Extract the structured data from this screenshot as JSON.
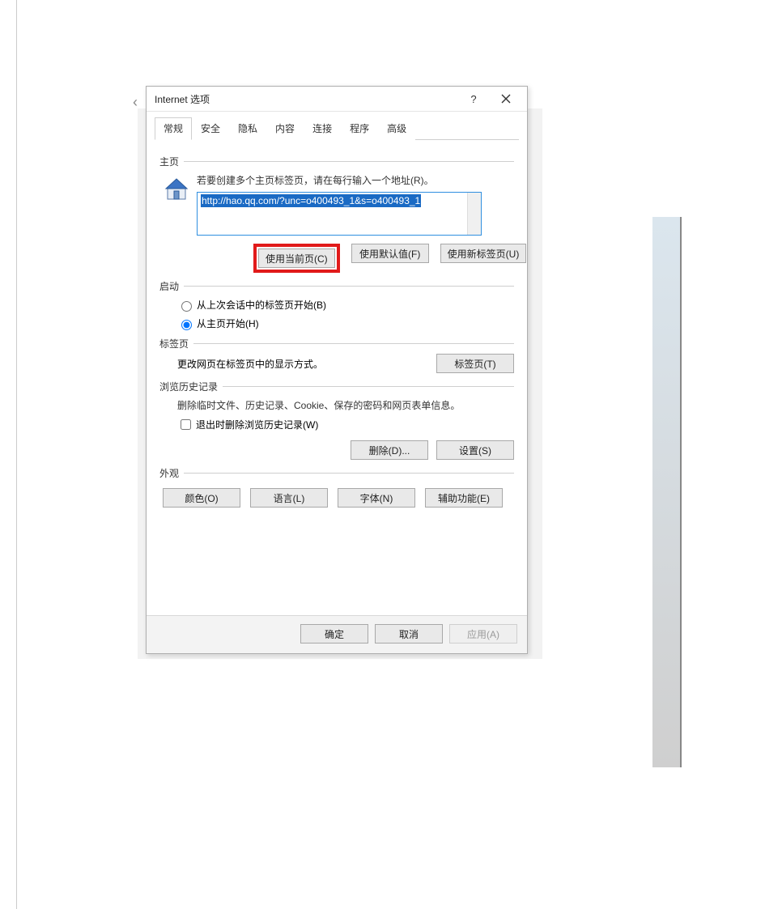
{
  "dialog": {
    "title": "Internet 选项",
    "tabs": [
      "常规",
      "安全",
      "隐私",
      "内容",
      "连接",
      "程序",
      "高级"
    ],
    "active_tab_index": 0
  },
  "homepage": {
    "section": "主页",
    "instruction": "若要创建多个主页标签页，请在每行输入一个地址(R)。",
    "url": "http://hao.qq.com/?unc=o400493_1&s=o400493_1",
    "btn_current": "使用当前页(C)",
    "btn_default": "使用默认值(F)",
    "btn_newtab": "使用新标签页(U)"
  },
  "startup": {
    "section": "启动",
    "opt_last": "从上次会话中的标签页开始(B)",
    "opt_home": "从主页开始(H)",
    "selected": "home"
  },
  "tabs_section": {
    "section": "标签页",
    "text": "更改网页在标签页中的显示方式。",
    "btn": "标签页(T)"
  },
  "history": {
    "section": "浏览历史记录",
    "text": "删除临时文件、历史记录、Cookie、保存的密码和网页表单信息。",
    "checkbox": "退出时删除浏览历史记录(W)",
    "btn_delete": "删除(D)...",
    "btn_settings": "设置(S)"
  },
  "appearance": {
    "section": "外观",
    "btn_color": "颜色(O)",
    "btn_lang": "语言(L)",
    "btn_font": "字体(N)",
    "btn_access": "辅助功能(E)"
  },
  "footer": {
    "ok": "确定",
    "cancel": "取消",
    "apply": "应用(A)"
  }
}
